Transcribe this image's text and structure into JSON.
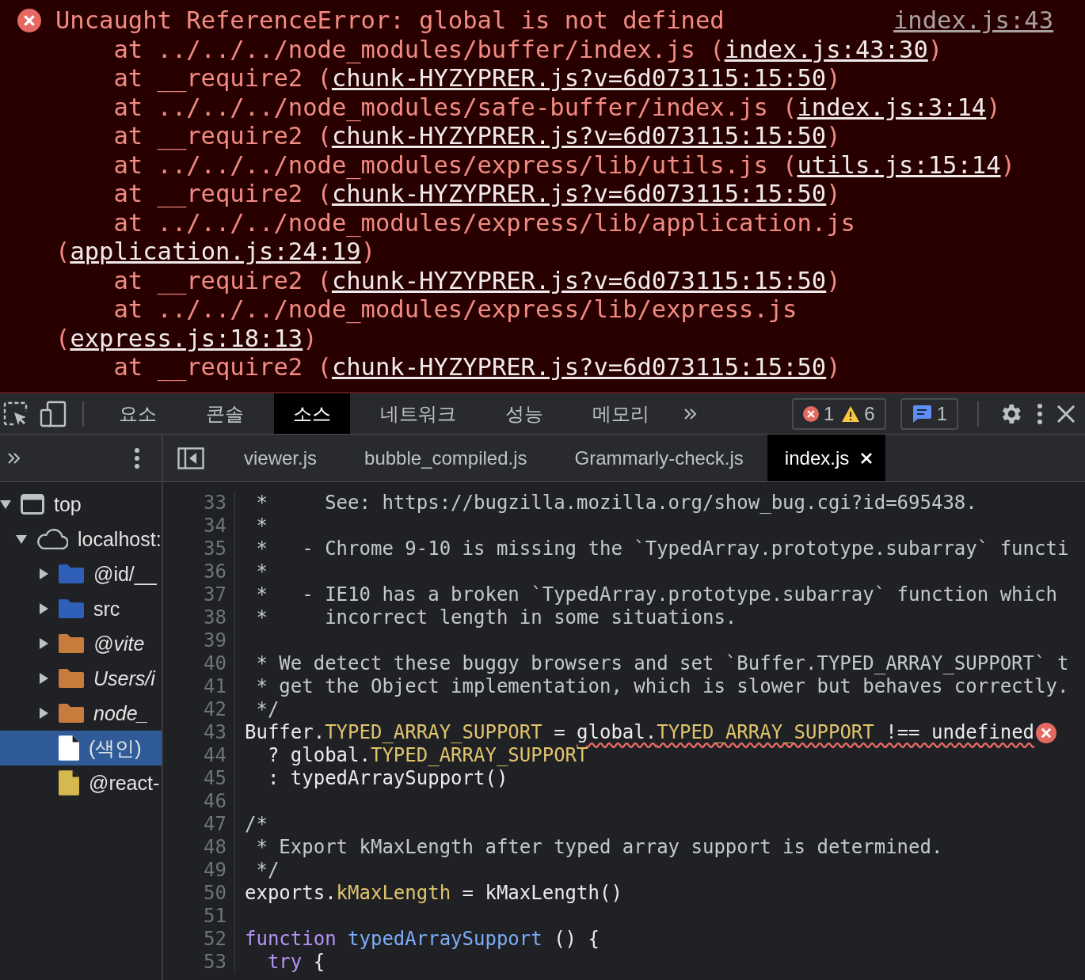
{
  "console": {
    "message": "Uncaught ReferenceError: global is not defined",
    "source_link": "index.js:43",
    "stack": [
      {
        "text": "at ../../../node_modules/buffer/index.js (",
        "link": "index.js:43:30",
        "end": ")"
      },
      {
        "text": "at __require2 (",
        "link": "chunk-HYZYPRER.js?v=6d073115:15:50",
        "end": ")"
      },
      {
        "text": "at ../../../node_modules/safe-buffer/index.js (",
        "link": "index.js:3:14",
        "end": ")"
      },
      {
        "text": "at __require2 (",
        "link": "chunk-HYZYPRER.js?v=6d073115:15:50",
        "end": ")"
      },
      {
        "text": "at ../../../node_modules/express/lib/utils.js (",
        "link": "utils.js:15:14",
        "end": ")"
      },
      {
        "text": "at __require2 (",
        "link": "chunk-HYZYPRER.js?v=6d073115:15:50",
        "end": ")"
      },
      {
        "text": "at ../../../node_modules/express/lib/application.js (",
        "link": "application.js:24:19",
        "end": ")"
      },
      {
        "text": "at __require2 (",
        "link": "chunk-HYZYPRER.js?v=6d073115:15:50",
        "end": ")"
      },
      {
        "text": "at ../../../node_modules/express/lib/express.js (",
        "link": "express.js:18:13",
        "end": ")"
      },
      {
        "text": "at __require2 (",
        "link": "chunk-HYZYPRER.js?v=6d073115:15:50",
        "end": ")"
      }
    ]
  },
  "tabs": [
    {
      "label": "요소",
      "selected": false
    },
    {
      "label": "콘솔",
      "selected": false
    },
    {
      "label": "소스",
      "selected": true
    },
    {
      "label": "네트워크",
      "selected": false
    },
    {
      "label": "성능",
      "selected": false
    },
    {
      "label": "메모리",
      "selected": false
    }
  ],
  "issues": [
    {
      "kind": "error",
      "count": "1"
    },
    {
      "kind": "warning",
      "count": "6"
    },
    {
      "kind": "message",
      "count": "1"
    }
  ],
  "file_tabs": [
    {
      "label": "viewer.js",
      "selected": false
    },
    {
      "label": "bubble_compiled.js",
      "selected": false
    },
    {
      "label": "Grammarly-check.js",
      "selected": false
    },
    {
      "label": "index.js",
      "selected": true
    }
  ],
  "sidebar": {
    "tree": [
      {
        "label": "top",
        "kind": "frame",
        "expanded": true,
        "selected": false,
        "children": [
          {
            "label": "localhost:",
            "kind": "origin",
            "expanded": true,
            "selected": false,
            "children": [
              {
                "label": "@id/__",
                "kind": "folder",
                "color": "#2f5fb8",
                "italic": false,
                "expanded": false,
                "selected": false
              },
              {
                "label": "src",
                "kind": "folder",
                "color": "#2f5fb8",
                "italic": false,
                "expanded": false,
                "selected": false
              },
              {
                "label": "@vite",
                "kind": "folder",
                "color": "#c77c3e",
                "italic": true,
                "expanded": false,
                "selected": false
              },
              {
                "label": "Users/i",
                "kind": "folder",
                "color": "#c77c3e",
                "italic": true,
                "expanded": false,
                "selected": false
              },
              {
                "label": "node_",
                "kind": "folder",
                "color": "#c77c3e",
                "italic": true,
                "expanded": false,
                "selected": false
              },
              {
                "label": "(색인)",
                "kind": "file",
                "color": "#ffffff",
                "italic": false,
                "selected": true
              },
              {
                "label": "@react-",
                "kind": "file",
                "color": "#d6b94e",
                "italic": false,
                "selected": false
              }
            ]
          }
        ]
      }
    ]
  },
  "code": {
    "lines": [
      {
        "number": "33",
        "error": false,
        "tokens": [
          {
            "kind": "comment",
            "text": " *     See: https://bugzilla.mozilla.org/show_bug.cgi?id=695438."
          }
        ]
      },
      {
        "number": "34",
        "error": false,
        "tokens": [
          {
            "kind": "comment",
            "text": " *"
          }
        ]
      },
      {
        "number": "35",
        "error": false,
        "tokens": [
          {
            "kind": "comment",
            "text": " *   - Chrome 9-10 is missing the `TypedArray.prototype.subarray` functi"
          }
        ]
      },
      {
        "number": "36",
        "error": false,
        "tokens": [
          {
            "kind": "comment",
            "text": " *"
          }
        ]
      },
      {
        "number": "37",
        "error": false,
        "tokens": [
          {
            "kind": "comment",
            "text": " *   - IE10 has a broken `TypedArray.prototype.subarray` function which"
          }
        ]
      },
      {
        "number": "38",
        "error": false,
        "tokens": [
          {
            "kind": "comment",
            "text": " *     incorrect length in some situations."
          }
        ]
      },
      {
        "number": "39",
        "error": false
      },
      {
        "number": "40",
        "error": false,
        "tokens": [
          {
            "kind": "comment",
            "text": " * We detect these buggy browsers and set `Buffer.TYPED_ARRAY_SUPPORT` t"
          }
        ]
      },
      {
        "number": "41",
        "error": false,
        "tokens": [
          {
            "kind": "comment",
            "text": " * get the Object implementation, which is slower but behaves correctly."
          }
        ]
      },
      {
        "number": "42",
        "error": false,
        "tokens": [
          {
            "kind": "comment",
            "text": " */"
          }
        ]
      },
      {
        "number": "43",
        "error": true,
        "tokens": [
          {
            "kind": "plain",
            "text": "Buffer."
          },
          {
            "kind": "property",
            "text": "TYPED_ARRAY_SUPPORT"
          },
          {
            "kind": "plain",
            "text": " = "
          },
          {
            "kind": "plain",
            "text": "global.",
            "squiggle": true
          },
          {
            "kind": "property",
            "text": "TYPED_ARRAY_SUPPORT",
            "squiggle": true
          },
          {
            "kind": "plain",
            "text": " !== undefined",
            "squiggle": true
          }
        ]
      },
      {
        "number": "44",
        "error": false,
        "tokens": [
          {
            "kind": "plain",
            "text": "  ? global."
          },
          {
            "kind": "property",
            "text": "TYPED_ARRAY_SUPPORT"
          }
        ]
      },
      {
        "number": "45",
        "error": false,
        "tokens": [
          {
            "kind": "plain",
            "text": "  : typedArraySupport()"
          }
        ]
      },
      {
        "number": "46",
        "error": false
      },
      {
        "number": "47",
        "error": false,
        "tokens": [
          {
            "kind": "comment",
            "text": "/*"
          }
        ]
      },
      {
        "number": "48",
        "error": false,
        "tokens": [
          {
            "kind": "comment",
            "text": " * Export kMaxLength after typed array support is determined."
          }
        ]
      },
      {
        "number": "49",
        "error": false,
        "tokens": [
          {
            "kind": "comment",
            "text": " */"
          }
        ]
      },
      {
        "number": "50",
        "error": false,
        "tokens": [
          {
            "kind": "plain",
            "text": "exports."
          },
          {
            "kind": "property",
            "text": "kMaxLength"
          },
          {
            "kind": "plain",
            "text": " = kMaxLength()"
          }
        ]
      },
      {
        "number": "51",
        "error": false
      },
      {
        "number": "52",
        "error": false,
        "tokens": [
          {
            "kind": "keyword",
            "text": "function"
          },
          {
            "kind": "function",
            "text": " typedArraySupport"
          },
          {
            "kind": "plain",
            "text": " () {"
          }
        ]
      },
      {
        "number": "53",
        "error": false,
        "tokens": [
          {
            "kind": "keyword",
            "text": "  try"
          },
          {
            "kind": "plain",
            "text": " {"
          }
        ]
      }
    ]
  }
}
